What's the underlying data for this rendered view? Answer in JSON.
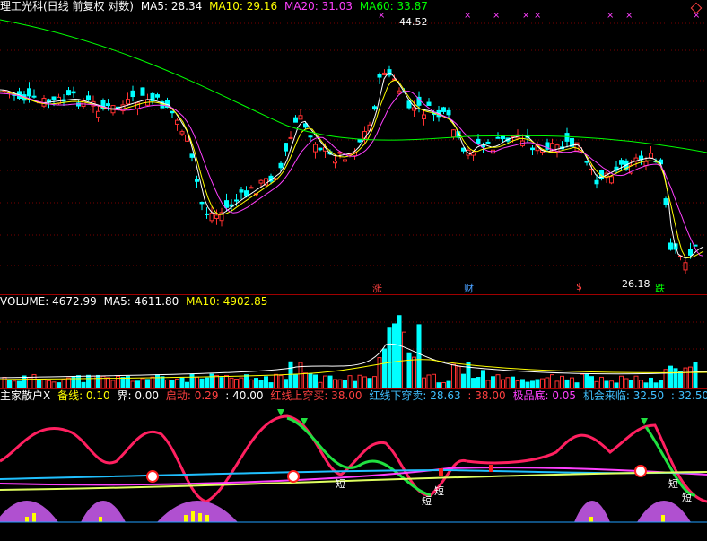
{
  "price_header": {
    "title": "理工光科(日线 前复权 对数)",
    "ma5_label": "MA5: 28.34",
    "ma10_label": "MA10: 29.16",
    "ma20_label": "MA20: 31.03",
    "ma60_label": "MA60: 33.87",
    "colors": {
      "title": "#ffffff",
      "ma5": "#ffffff",
      "ma10": "#ffff00",
      "ma20": "#ff40ff",
      "ma60": "#00ff00"
    }
  },
  "price_labels": {
    "high": "44.52",
    "low": "26.18",
    "tag_zhang": "涨",
    "tag_cai": "财",
    "tag_dollar": "$",
    "tag_die": "跌"
  },
  "volume_header": {
    "volume_label": "VOLUME: 4672.99",
    "ma5_label": "MA5: 4611.80",
    "ma10_label": "MA10: 4902.85",
    "colors": {
      "volume": "#ffffff",
      "ma5": "#ffffff",
      "ma10": "#ffff00"
    }
  },
  "indicator_header": {
    "name": "主家散户X",
    "baseline": "备线: 0.10",
    "jie": "界: 0.00",
    "qidong": "启动: 0.29",
    "v40": ": 40.00",
    "hongxian_up": "红线上穿买: 38.00",
    "hongxian_down": "红线下穿卖: 28.63",
    "v38": ": 38.00",
    "jipindi": "极品底: 0.05",
    "jihui": "机会来临: 32.50",
    "v3250": ": 32.50",
    "zhong": "中"
  },
  "indicator_labels": {
    "duan": "短"
  },
  "chart_data": {
    "type": "candlestick",
    "title": "理工光科(日线 前复权 对数)",
    "series": [
      {
        "name": "MA5",
        "last": 28.34
      },
      {
        "name": "MA10",
        "last": 29.16
      },
      {
        "name": "MA20",
        "last": 31.03
      },
      {
        "name": "MA60",
        "last": 33.87
      }
    ],
    "annotations": {
      "max": 44.52,
      "min": 26.18
    },
    "volume": {
      "VOLUME": 4672.99,
      "MA5": 4611.8,
      "MA10": 4902.85
    }
  }
}
